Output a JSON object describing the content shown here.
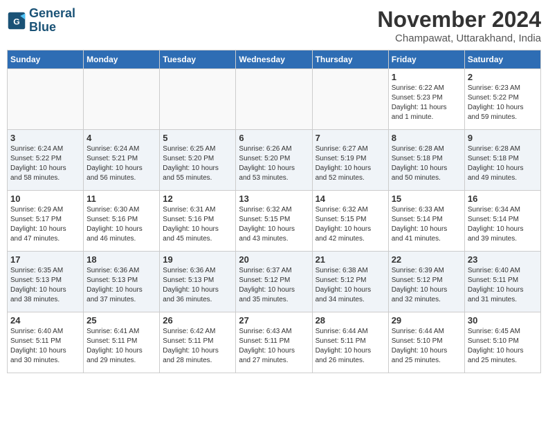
{
  "logo": {
    "line1": "General",
    "line2": "Blue"
  },
  "title": "November 2024",
  "location": "Champawat, Uttarakhand, India",
  "headers": [
    "Sunday",
    "Monday",
    "Tuesday",
    "Wednesday",
    "Thursday",
    "Friday",
    "Saturday"
  ],
  "weeks": [
    [
      {
        "day": "",
        "info": ""
      },
      {
        "day": "",
        "info": ""
      },
      {
        "day": "",
        "info": ""
      },
      {
        "day": "",
        "info": ""
      },
      {
        "day": "",
        "info": ""
      },
      {
        "day": "1",
        "info": "Sunrise: 6:22 AM\nSunset: 5:23 PM\nDaylight: 11 hours\nand 1 minute."
      },
      {
        "day": "2",
        "info": "Sunrise: 6:23 AM\nSunset: 5:22 PM\nDaylight: 10 hours\nand 59 minutes."
      }
    ],
    [
      {
        "day": "3",
        "info": "Sunrise: 6:24 AM\nSunset: 5:22 PM\nDaylight: 10 hours\nand 58 minutes."
      },
      {
        "day": "4",
        "info": "Sunrise: 6:24 AM\nSunset: 5:21 PM\nDaylight: 10 hours\nand 56 minutes."
      },
      {
        "day": "5",
        "info": "Sunrise: 6:25 AM\nSunset: 5:20 PM\nDaylight: 10 hours\nand 55 minutes."
      },
      {
        "day": "6",
        "info": "Sunrise: 6:26 AM\nSunset: 5:20 PM\nDaylight: 10 hours\nand 53 minutes."
      },
      {
        "day": "7",
        "info": "Sunrise: 6:27 AM\nSunset: 5:19 PM\nDaylight: 10 hours\nand 52 minutes."
      },
      {
        "day": "8",
        "info": "Sunrise: 6:28 AM\nSunset: 5:18 PM\nDaylight: 10 hours\nand 50 minutes."
      },
      {
        "day": "9",
        "info": "Sunrise: 6:28 AM\nSunset: 5:18 PM\nDaylight: 10 hours\nand 49 minutes."
      }
    ],
    [
      {
        "day": "10",
        "info": "Sunrise: 6:29 AM\nSunset: 5:17 PM\nDaylight: 10 hours\nand 47 minutes."
      },
      {
        "day": "11",
        "info": "Sunrise: 6:30 AM\nSunset: 5:16 PM\nDaylight: 10 hours\nand 46 minutes."
      },
      {
        "day": "12",
        "info": "Sunrise: 6:31 AM\nSunset: 5:16 PM\nDaylight: 10 hours\nand 45 minutes."
      },
      {
        "day": "13",
        "info": "Sunrise: 6:32 AM\nSunset: 5:15 PM\nDaylight: 10 hours\nand 43 minutes."
      },
      {
        "day": "14",
        "info": "Sunrise: 6:32 AM\nSunset: 5:15 PM\nDaylight: 10 hours\nand 42 minutes."
      },
      {
        "day": "15",
        "info": "Sunrise: 6:33 AM\nSunset: 5:14 PM\nDaylight: 10 hours\nand 41 minutes."
      },
      {
        "day": "16",
        "info": "Sunrise: 6:34 AM\nSunset: 5:14 PM\nDaylight: 10 hours\nand 39 minutes."
      }
    ],
    [
      {
        "day": "17",
        "info": "Sunrise: 6:35 AM\nSunset: 5:13 PM\nDaylight: 10 hours\nand 38 minutes."
      },
      {
        "day": "18",
        "info": "Sunrise: 6:36 AM\nSunset: 5:13 PM\nDaylight: 10 hours\nand 37 minutes."
      },
      {
        "day": "19",
        "info": "Sunrise: 6:36 AM\nSunset: 5:13 PM\nDaylight: 10 hours\nand 36 minutes."
      },
      {
        "day": "20",
        "info": "Sunrise: 6:37 AM\nSunset: 5:12 PM\nDaylight: 10 hours\nand 35 minutes."
      },
      {
        "day": "21",
        "info": "Sunrise: 6:38 AM\nSunset: 5:12 PM\nDaylight: 10 hours\nand 34 minutes."
      },
      {
        "day": "22",
        "info": "Sunrise: 6:39 AM\nSunset: 5:12 PM\nDaylight: 10 hours\nand 32 minutes."
      },
      {
        "day": "23",
        "info": "Sunrise: 6:40 AM\nSunset: 5:11 PM\nDaylight: 10 hours\nand 31 minutes."
      }
    ],
    [
      {
        "day": "24",
        "info": "Sunrise: 6:40 AM\nSunset: 5:11 PM\nDaylight: 10 hours\nand 30 minutes."
      },
      {
        "day": "25",
        "info": "Sunrise: 6:41 AM\nSunset: 5:11 PM\nDaylight: 10 hours\nand 29 minutes."
      },
      {
        "day": "26",
        "info": "Sunrise: 6:42 AM\nSunset: 5:11 PM\nDaylight: 10 hours\nand 28 minutes."
      },
      {
        "day": "27",
        "info": "Sunrise: 6:43 AM\nSunset: 5:11 PM\nDaylight: 10 hours\nand 27 minutes."
      },
      {
        "day": "28",
        "info": "Sunrise: 6:44 AM\nSunset: 5:11 PM\nDaylight: 10 hours\nand 26 minutes."
      },
      {
        "day": "29",
        "info": "Sunrise: 6:44 AM\nSunset: 5:10 PM\nDaylight: 10 hours\nand 25 minutes."
      },
      {
        "day": "30",
        "info": "Sunrise: 6:45 AM\nSunset: 5:10 PM\nDaylight: 10 hours\nand 25 minutes."
      }
    ]
  ]
}
